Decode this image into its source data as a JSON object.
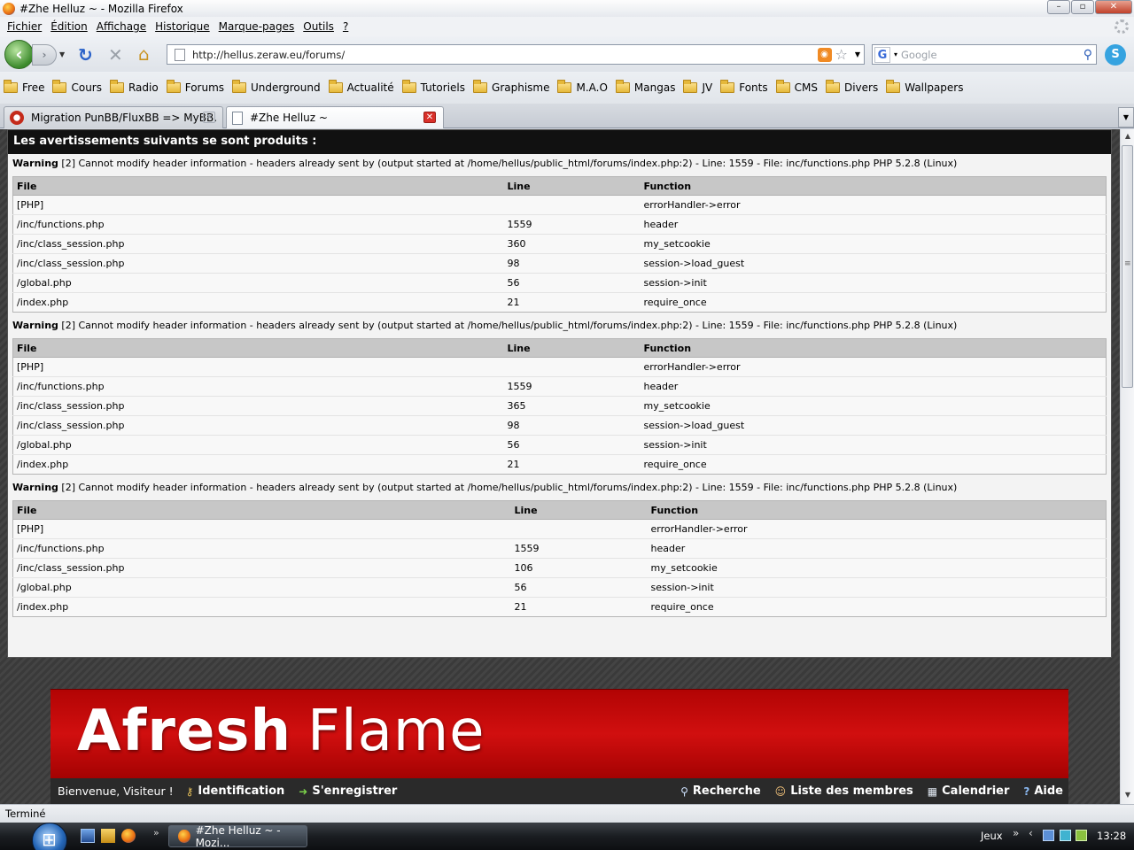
{
  "window": {
    "title": "#Zhe Helluz ~ - Mozilla Firefox"
  },
  "menu": [
    "Fichier",
    "Édition",
    "Affichage",
    "Historique",
    "Marque-pages",
    "Outils",
    "?"
  ],
  "toolbar": {
    "url": "http://hellus.zeraw.eu/forums/",
    "search_placeholder": "Google"
  },
  "bookmarks": [
    "Free",
    "Cours",
    "Radio",
    "Forums",
    "Underground",
    "Actualité",
    "Tutoriels",
    "Graphisme",
    "M.A.O",
    "Mangas",
    "JV",
    "Fonts",
    "CMS",
    "Divers",
    "Wallpapers"
  ],
  "tabs": [
    {
      "label": "Migration PunBB/FluxBB => MyBB.",
      "active": false
    },
    {
      "label": "#Zhe Helluz ~",
      "active": true
    }
  ],
  "warnings": {
    "header": "Les avertissements suivants se sont produits :",
    "columns": [
      "File",
      "Line",
      "Function"
    ],
    "items": [
      {
        "label": "Warning",
        "message": "[2] Cannot modify header information - headers already sent by (output started at /home/hellus/public_html/forums/index.php:2) - Line: 1559 - File: inc/functions.php PHP 5.2.8 (Linux)",
        "rows": [
          [
            "[PHP]",
            "",
            "errorHandler->error"
          ],
          [
            "/inc/functions.php",
            "1559",
            "header"
          ],
          [
            "/inc/class_session.php",
            "360",
            "my_setcookie"
          ],
          [
            "/inc/class_session.php",
            "98",
            "session->load_guest"
          ],
          [
            "/global.php",
            "56",
            "session->init"
          ],
          [
            "/index.php",
            "21",
            "require_once"
          ]
        ]
      },
      {
        "label": "Warning",
        "message": "[2] Cannot modify header information - headers already sent by (output started at /home/hellus/public_html/forums/index.php:2) - Line: 1559 - File: inc/functions.php PHP 5.2.8 (Linux)",
        "rows": [
          [
            "[PHP]",
            "",
            "errorHandler->error"
          ],
          [
            "/inc/functions.php",
            "1559",
            "header"
          ],
          [
            "/inc/class_session.php",
            "365",
            "my_setcookie"
          ],
          [
            "/inc/class_session.php",
            "98",
            "session->load_guest"
          ],
          [
            "/global.php",
            "56",
            "session->init"
          ],
          [
            "/index.php",
            "21",
            "require_once"
          ]
        ]
      },
      {
        "label": "Warning",
        "message": "[2] Cannot modify header information - headers already sent by (output started at /home/hellus/public_html/forums/index.php:2) - Line: 1559 - File: inc/functions.php PHP 5.2.8 (Linux)",
        "rows": [
          [
            "[PHP]",
            "",
            "errorHandler->error"
          ],
          [
            "/inc/functions.php",
            "1559",
            "header"
          ],
          [
            "/inc/class_session.php",
            "106",
            "my_setcookie"
          ],
          [
            "/global.php",
            "56",
            "session->init"
          ],
          [
            "/index.php",
            "21",
            "require_once"
          ]
        ]
      }
    ]
  },
  "forum": {
    "logo_bold": "Afresh",
    "logo_light": "Flame",
    "welcome": "Bienvenue, Visiteur !",
    "left_links": [
      {
        "label": "Identification",
        "icon": "key-icon"
      },
      {
        "label": "S'enregistrer",
        "icon": "arrow-right-icon"
      }
    ],
    "right_links": [
      {
        "label": "Recherche",
        "icon": "search-icon"
      },
      {
        "label": "Liste des membres",
        "icon": "members-icon"
      },
      {
        "label": "Calendrier",
        "icon": "calendar-icon"
      },
      {
        "label": "Aide",
        "icon": "help-icon"
      }
    ],
    "banner_color": "#c40a0a"
  },
  "status": {
    "text": "Terminé"
  },
  "taskbar": {
    "task": "#Zhe Helluz ~ - Mozi...",
    "toolbar_label": "Jeux",
    "clock": "13:28"
  }
}
